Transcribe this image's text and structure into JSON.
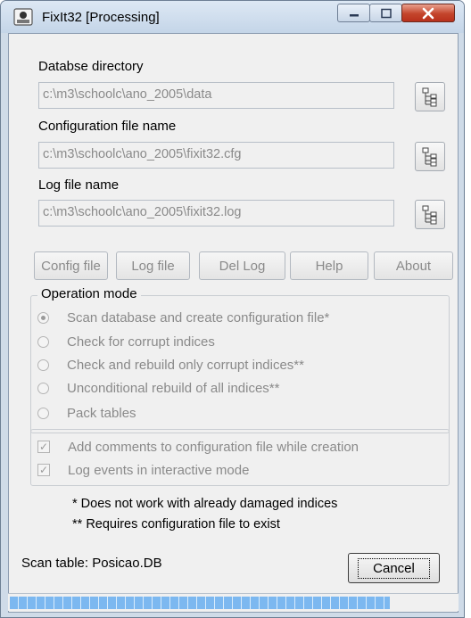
{
  "window": {
    "title": "FixIt32 [Processing]"
  },
  "title_controls": {
    "minimize": "minimize",
    "maximize": "maximize",
    "close": "close"
  },
  "paths": {
    "database_label": "Databse directory",
    "database_value": "c:\\m3\\schoolc\\ano_2005\\data",
    "config_label": "Configuration file name",
    "config_value": "c:\\m3\\schoolc\\ano_2005\\fixit32.cfg",
    "log_label": "Log file name",
    "log_value": "c:\\m3\\schoolc\\ano_2005\\fixit32.log"
  },
  "buttons": {
    "config_file": "Config file",
    "log_file": "Log file",
    "del_log": "Del Log",
    "help": "Help",
    "about": "About"
  },
  "operation_mode": {
    "title": "Operation mode",
    "options": [
      {
        "label": "Scan database and create configuration file*",
        "selected": true
      },
      {
        "label": "Check for corrupt indices",
        "selected": false
      },
      {
        "label": "Check and rebuild only corrupt indices**",
        "selected": false
      },
      {
        "label": "Unconditional rebuild of all indices**",
        "selected": false
      },
      {
        "label": "Pack tables",
        "selected": false
      }
    ]
  },
  "options": [
    {
      "label": "Add comments to configuration file while creation",
      "checked": true
    },
    {
      "label": "Log events in interactive mode",
      "checked": true
    }
  ],
  "notes": {
    "note1": "* Does not work with already damaged indices",
    "note2": "** Requires configuration file to exist"
  },
  "status": {
    "text": "Scan table: Posicao.DB",
    "progress_percent": 85
  },
  "cancel_label": "Cancel",
  "colors": {
    "progress": "#7cb8f0",
    "close_button": "#c4452c"
  }
}
